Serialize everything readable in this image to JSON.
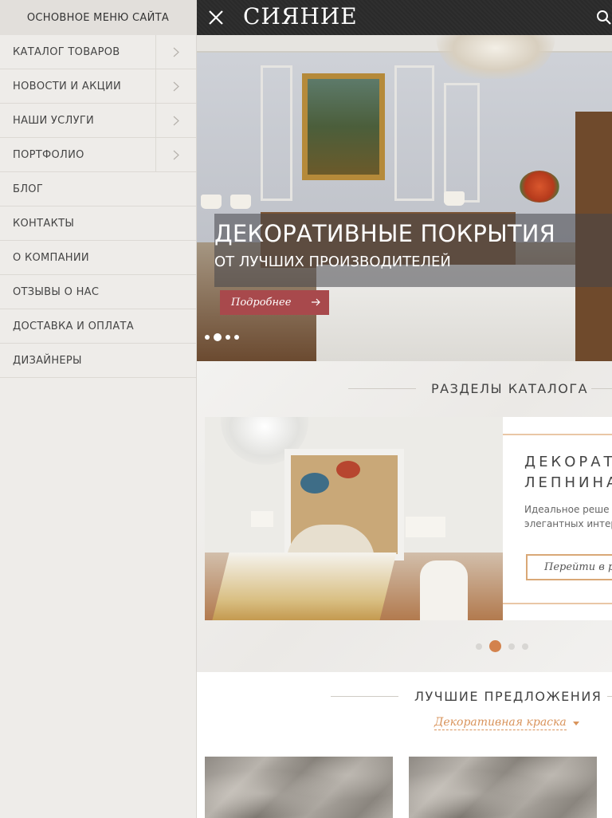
{
  "sidebar": {
    "title": "ОСНОВНОЕ МЕНЮ САЙТА",
    "items": [
      {
        "label": "КАТАЛОГ ТОВАРОВ"
      },
      {
        "label": "НОВОСТИ И АКЦИИ"
      },
      {
        "label": "НАШИ УСЛУГИ"
      },
      {
        "label": "ПОРТФОЛИО"
      },
      {
        "label": "БЛОГ"
      },
      {
        "label": "КОНТАКТЫ"
      },
      {
        "label": "О КОМПАНИИ"
      },
      {
        "label": "ОТЗЫВЫ О НАС"
      },
      {
        "label": "ДОСТАВКА И ОПЛАТА"
      },
      {
        "label": "ДИЗАЙНЕРЫ"
      }
    ]
  },
  "header": {
    "logo": "СИЯНИЕ",
    "close_icon": "close-icon",
    "search_icon": "search-icon"
  },
  "hero": {
    "title": "ДЕКОРАТИВНЫЕ ПОКРЫТИЯ",
    "subtitle": "ОТ ЛУЧШИХ ПРОИЗВОДИТЕЛЕЙ",
    "button_label": "Подробнее",
    "slide_count": 4,
    "active_slide": 2
  },
  "catalog": {
    "section_title": "РАЗДЕЛЫ КАТАЛОГА",
    "card_title": "ДЕКОРАТ\nЛЕПНИНА",
    "card_desc": "Идеальное реше\nэлегантных интер",
    "card_button": "Перейти в ра",
    "page_count": 4,
    "active_page": 2
  },
  "offers": {
    "section_title": "ЛУЧШИЕ ПРЕДЛОЖЕНИЯ",
    "filter_value": "Декоративная краска"
  },
  "colors": {
    "accent": "#a8494c",
    "highlight": "#d3824d",
    "header_bg": "#2a2a2a",
    "sidebar_bg": "#eeece9"
  }
}
